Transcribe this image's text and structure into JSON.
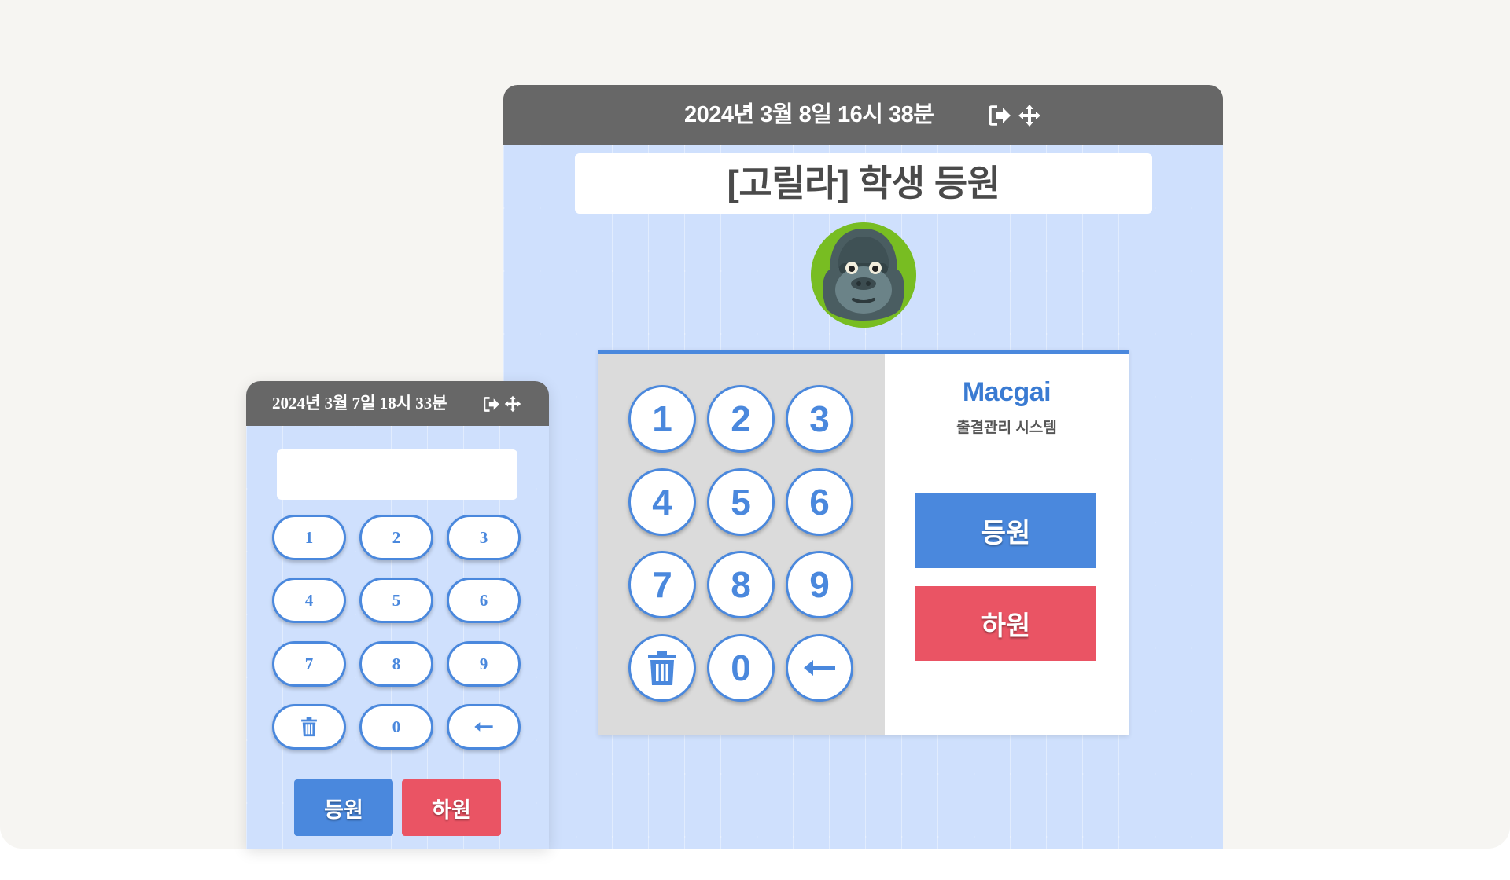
{
  "large_window": {
    "datetime": "2024년 3월 8일 16시 38분",
    "title": "[고릴라] 학생 등원",
    "avatar_icon": "gorilla-icon",
    "keypad": [
      "1",
      "2",
      "3",
      "4",
      "5",
      "6",
      "7",
      "8",
      "9",
      "delete",
      "0",
      "backspace"
    ],
    "keys": {
      "k1": "1",
      "k2": "2",
      "k3": "3",
      "k4": "4",
      "k5": "5",
      "k6": "6",
      "k7": "7",
      "k8": "8",
      "k9": "9",
      "k0": "0"
    },
    "brand_name": "Macgai",
    "brand_subtitle": "출결관리 시스템",
    "checkin_label": "등원",
    "checkout_label": "하원"
  },
  "small_window": {
    "datetime": "2024년 3월 7일 18시 33분",
    "input_value": "",
    "keys": {
      "k1": "1",
      "k2": "2",
      "k3": "3",
      "k4": "4",
      "k5": "5",
      "k6": "6",
      "k7": "7",
      "k8": "8",
      "k9": "9",
      "k0": "0"
    },
    "checkin_label": "등원",
    "checkout_label": "하원"
  },
  "colors": {
    "accent_blue": "#4a88dd",
    "checkout_red": "#ea5464",
    "titlebar_gray": "#676767",
    "pattern_blue": "#cfe0fd"
  }
}
